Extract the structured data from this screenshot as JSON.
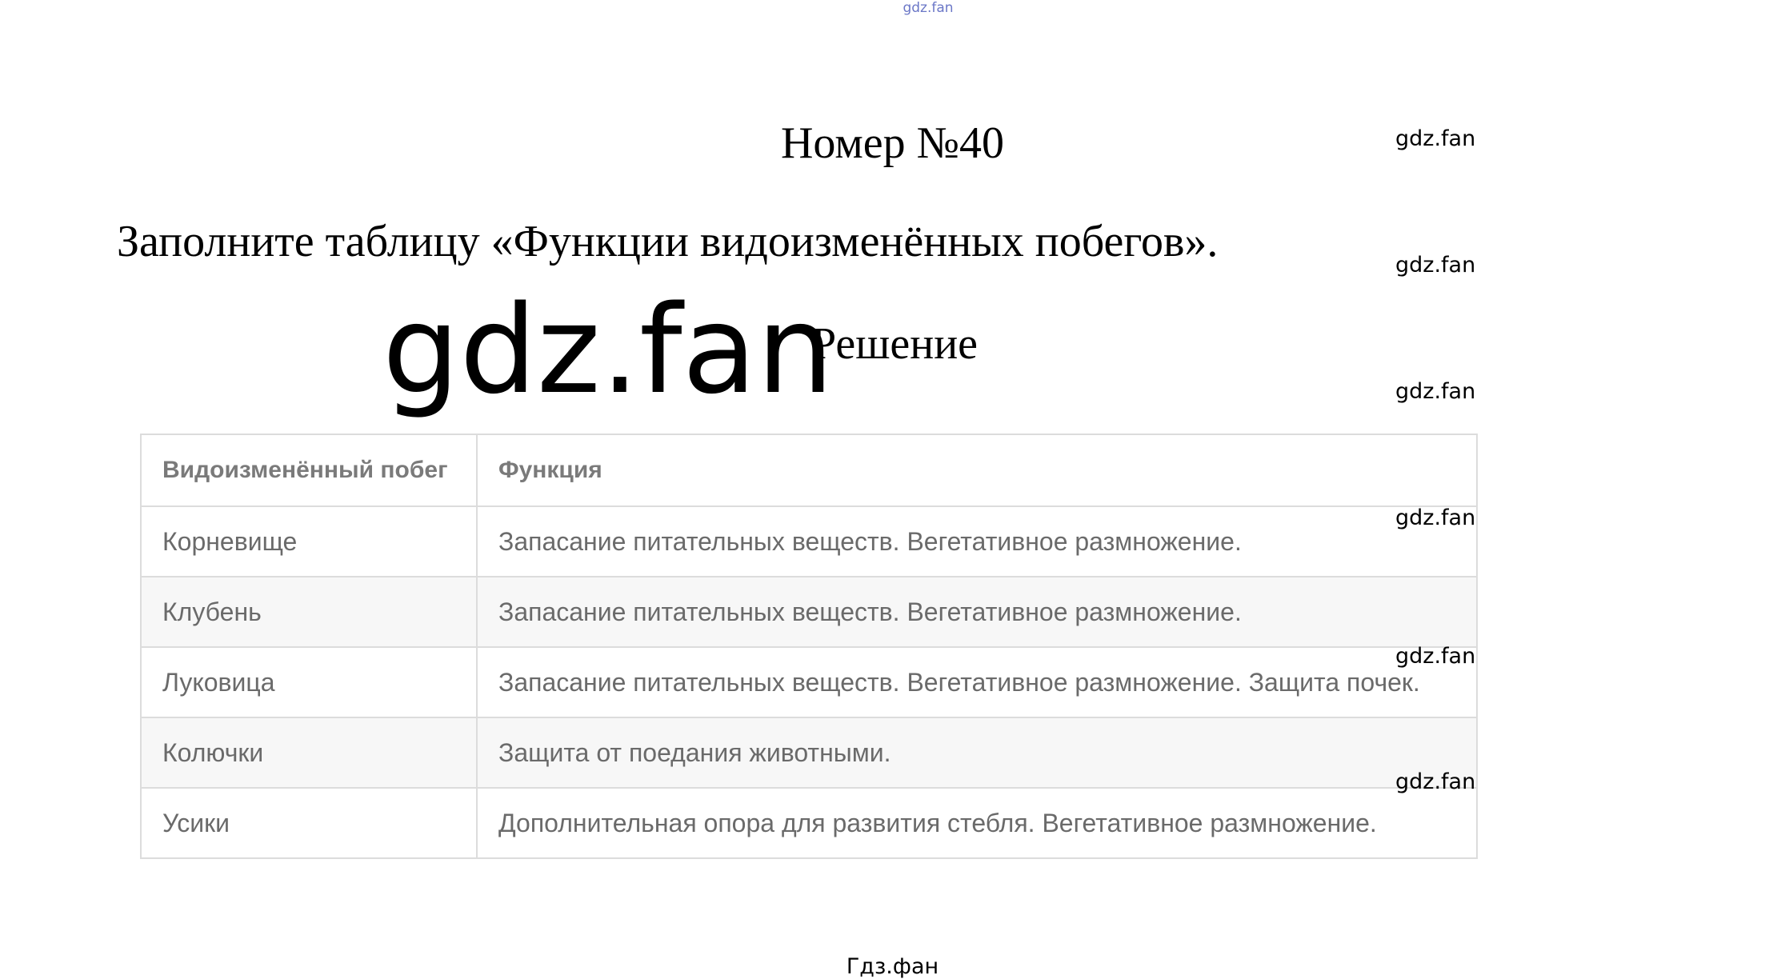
{
  "watermark_top": "gdz.fan",
  "title": "Номер №40",
  "task": "Заполните таблицу «Функции видоизменённых побегов».",
  "watermark_big": "gdz.fan",
  "solution_label": "Решение",
  "side_watermarks": [
    "gdz.fan",
    "gdz.fan",
    "gdz.fan",
    "gdz.fan",
    "gdz.fan",
    "gdz.fan"
  ],
  "table": {
    "headers": [
      "Видоизменённый побег",
      "Функция"
    ],
    "rows": [
      [
        "Корневище",
        "Запасание питательных веществ. Вегетативное размножение."
      ],
      [
        "Клубень",
        "Запасание питательных веществ. Вегетативное размножение."
      ],
      [
        "Луковица",
        "Запасание питательных веществ. Вегетативное размножение. Защита почек."
      ],
      [
        "Колючки",
        "Защита от поедания животными."
      ],
      [
        "Усики",
        "Дополнительная опора для развития стебля. Вегетативное размножение."
      ]
    ]
  },
  "footer": "Гдз.фан"
}
